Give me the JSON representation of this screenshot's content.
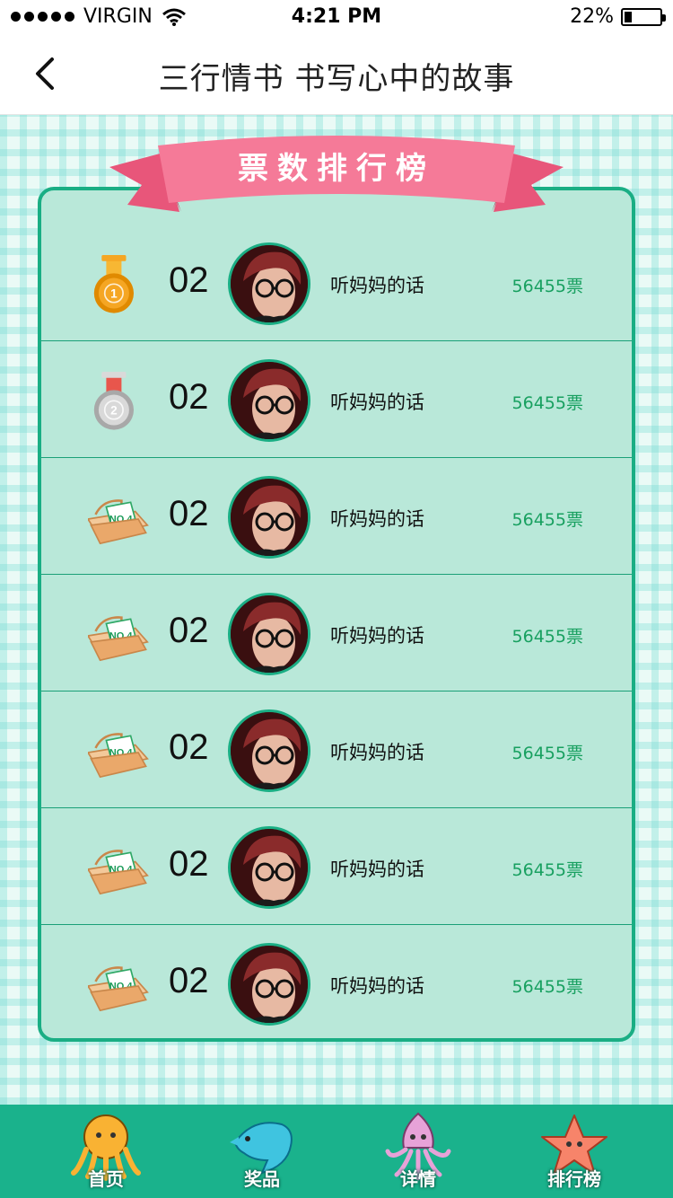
{
  "status": {
    "carrier": "VIRGIN",
    "time": "4:21 PM",
    "battery": "22%",
    "battery_level": 0.22
  },
  "nav": {
    "title": "三行情书 书写心中的故事"
  },
  "ribbon": {
    "title": "票数排行榜"
  },
  "colors": {
    "accent": "#1ab28c",
    "board": "#b9e8d9",
    "ribbon": "#f57a98",
    "votes": "#18a060"
  },
  "rankings": [
    {
      "medal": "gold-medal-icon",
      "badge": "1",
      "number": "02",
      "name": "听妈妈的话",
      "votes": "56455票"
    },
    {
      "medal": "silver-medal-icon",
      "badge": "2",
      "number": "02",
      "name": "听妈妈的话",
      "votes": "56455票"
    },
    {
      "medal": "basket-icon",
      "badge": "NO.4",
      "number": "02",
      "name": "听妈妈的话",
      "votes": "56455票"
    },
    {
      "medal": "basket-icon",
      "badge": "NO.4",
      "number": "02",
      "name": "听妈妈的话",
      "votes": "56455票"
    },
    {
      "medal": "basket-icon",
      "badge": "NO.4",
      "number": "02",
      "name": "听妈妈的话",
      "votes": "56455票"
    },
    {
      "medal": "basket-icon",
      "badge": "NO.4",
      "number": "02",
      "name": "听妈妈的话",
      "votes": "56455票"
    },
    {
      "medal": "basket-icon",
      "badge": "NO.4",
      "number": "02",
      "name": "听妈妈的话",
      "votes": "56455票"
    }
  ],
  "tabs": [
    {
      "label": "首页",
      "icon": "octopus-icon"
    },
    {
      "label": "奖品",
      "icon": "dolphin-icon"
    },
    {
      "label": "详情",
      "icon": "squid-icon"
    },
    {
      "label": "排行榜",
      "icon": "starfish-icon"
    }
  ]
}
